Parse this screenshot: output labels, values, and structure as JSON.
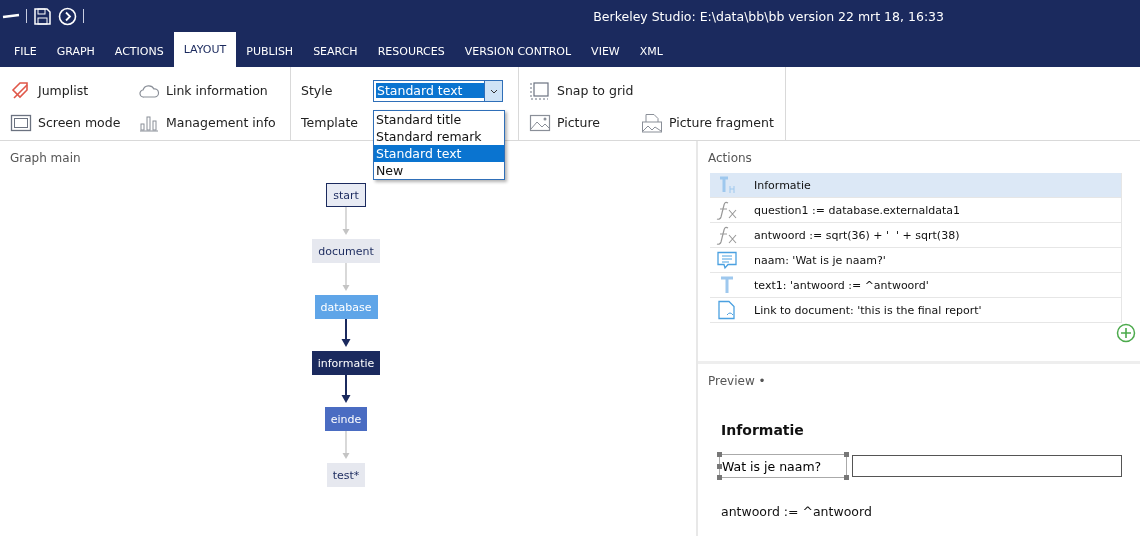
{
  "window": {
    "title": "Berkeley Studio: E:\\data\\bb\\bb version 22 mrt 18, 16:33"
  },
  "menu_tabs": [
    {
      "label": "FILE",
      "selected": false
    },
    {
      "label": "GRAPH",
      "selected": false
    },
    {
      "label": "ACTIONS",
      "selected": false
    },
    {
      "label": "LAYOUT",
      "selected": true
    },
    {
      "label": "PUBLISH",
      "selected": false
    },
    {
      "label": "SEARCH",
      "selected": false
    },
    {
      "label": "RESOURCES",
      "selected": false
    },
    {
      "label": "VERSION CONTROL",
      "selected": false
    },
    {
      "label": "VIEW",
      "selected": false
    },
    {
      "label": "XML",
      "selected": false
    }
  ],
  "ribbon": {
    "commands": [
      {
        "label": "Jumplist",
        "kind": "jumplist"
      },
      {
        "label": "Link information",
        "kind": "cloud"
      },
      {
        "label": "Screen mode",
        "kind": "screen"
      },
      {
        "label": "Management info",
        "kind": "bars"
      }
    ],
    "style_label": "Style",
    "template_label": "Template",
    "style_value": "Standard text",
    "style_options": [
      {
        "label": "Standard title",
        "selected": false
      },
      {
        "label": "Standard remark",
        "selected": false
      },
      {
        "label": "Standard text",
        "selected": true
      },
      {
        "label": "New",
        "selected": false
      }
    ],
    "layout_commands": [
      {
        "label": "Snap to grid",
        "kind": "snap"
      },
      {
        "label": "Picture",
        "kind": "picture"
      },
      {
        "label": "Picture fragment",
        "kind": "fragment"
      }
    ]
  },
  "graph": {
    "title": "Graph main",
    "nodes": [
      {
        "label": "start",
        "kind": "start",
        "color": "#e8ebf4"
      },
      {
        "label": "document",
        "kind": "light",
        "color": "#e6e8ef",
        "highlighted_arrow": false
      },
      {
        "label": "database",
        "kind": "dark",
        "color": "#5fa5e8",
        "highlighted_arrow": false
      },
      {
        "label": "informatie",
        "kind": "dark",
        "color": "#1b2a5e",
        "highlighted_arrow": true
      },
      {
        "label": "einde",
        "kind": "dark",
        "color": "#4a6cc2",
        "highlighted_arrow": true
      },
      {
        "label": "test*",
        "kind": "light",
        "color": "#e6e8ef",
        "highlighted_arrow": false
      }
    ]
  },
  "actions": {
    "title": "Actions",
    "rows": [
      {
        "text": "Informatie",
        "kind": "heading",
        "selected": true
      },
      {
        "text": "question1 := database.externaldata1",
        "kind": "function",
        "selected": false
      },
      {
        "text": "antwoord := sqrt(36) + '  ' + sqrt(38)",
        "kind": "function",
        "selected": false
      },
      {
        "text": "naam: 'Wat is je naam?'",
        "kind": "question",
        "selected": false
      },
      {
        "text": "text1: 'antwoord := ^antwoord'",
        "kind": "text",
        "selected": false
      },
      {
        "text": "Link to document: 'this is the final report'",
        "kind": "link",
        "selected": false
      }
    ]
  },
  "preview": {
    "title": "Preview •",
    "heading": "Informatie",
    "question": "Wat is je naam?",
    "text": "antwoord := ^antwoord"
  }
}
